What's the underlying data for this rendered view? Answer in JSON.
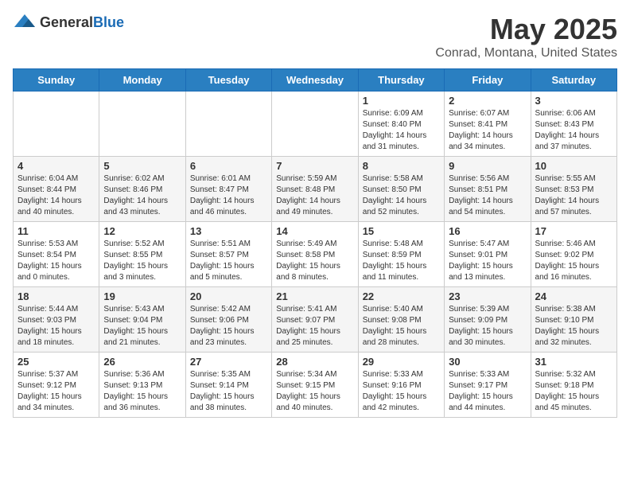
{
  "logo": {
    "text_general": "General",
    "text_blue": "Blue"
  },
  "header": {
    "month_year": "May 2025",
    "location": "Conrad, Montana, United States"
  },
  "weekdays": [
    "Sunday",
    "Monday",
    "Tuesday",
    "Wednesday",
    "Thursday",
    "Friday",
    "Saturday"
  ],
  "weeks": [
    [
      {
        "day": "",
        "info": ""
      },
      {
        "day": "",
        "info": ""
      },
      {
        "day": "",
        "info": ""
      },
      {
        "day": "",
        "info": ""
      },
      {
        "day": "1",
        "info": "Sunrise: 6:09 AM\nSunset: 8:40 PM\nDaylight: 14 hours\nand 31 minutes."
      },
      {
        "day": "2",
        "info": "Sunrise: 6:07 AM\nSunset: 8:41 PM\nDaylight: 14 hours\nand 34 minutes."
      },
      {
        "day": "3",
        "info": "Sunrise: 6:06 AM\nSunset: 8:43 PM\nDaylight: 14 hours\nand 37 minutes."
      }
    ],
    [
      {
        "day": "4",
        "info": "Sunrise: 6:04 AM\nSunset: 8:44 PM\nDaylight: 14 hours\nand 40 minutes."
      },
      {
        "day": "5",
        "info": "Sunrise: 6:02 AM\nSunset: 8:46 PM\nDaylight: 14 hours\nand 43 minutes."
      },
      {
        "day": "6",
        "info": "Sunrise: 6:01 AM\nSunset: 8:47 PM\nDaylight: 14 hours\nand 46 minutes."
      },
      {
        "day": "7",
        "info": "Sunrise: 5:59 AM\nSunset: 8:48 PM\nDaylight: 14 hours\nand 49 minutes."
      },
      {
        "day": "8",
        "info": "Sunrise: 5:58 AM\nSunset: 8:50 PM\nDaylight: 14 hours\nand 52 minutes."
      },
      {
        "day": "9",
        "info": "Sunrise: 5:56 AM\nSunset: 8:51 PM\nDaylight: 14 hours\nand 54 minutes."
      },
      {
        "day": "10",
        "info": "Sunrise: 5:55 AM\nSunset: 8:53 PM\nDaylight: 14 hours\nand 57 minutes."
      }
    ],
    [
      {
        "day": "11",
        "info": "Sunrise: 5:53 AM\nSunset: 8:54 PM\nDaylight: 15 hours\nand 0 minutes."
      },
      {
        "day": "12",
        "info": "Sunrise: 5:52 AM\nSunset: 8:55 PM\nDaylight: 15 hours\nand 3 minutes."
      },
      {
        "day": "13",
        "info": "Sunrise: 5:51 AM\nSunset: 8:57 PM\nDaylight: 15 hours\nand 5 minutes."
      },
      {
        "day": "14",
        "info": "Sunrise: 5:49 AM\nSunset: 8:58 PM\nDaylight: 15 hours\nand 8 minutes."
      },
      {
        "day": "15",
        "info": "Sunrise: 5:48 AM\nSunset: 8:59 PM\nDaylight: 15 hours\nand 11 minutes."
      },
      {
        "day": "16",
        "info": "Sunrise: 5:47 AM\nSunset: 9:01 PM\nDaylight: 15 hours\nand 13 minutes."
      },
      {
        "day": "17",
        "info": "Sunrise: 5:46 AM\nSunset: 9:02 PM\nDaylight: 15 hours\nand 16 minutes."
      }
    ],
    [
      {
        "day": "18",
        "info": "Sunrise: 5:44 AM\nSunset: 9:03 PM\nDaylight: 15 hours\nand 18 minutes."
      },
      {
        "day": "19",
        "info": "Sunrise: 5:43 AM\nSunset: 9:04 PM\nDaylight: 15 hours\nand 21 minutes."
      },
      {
        "day": "20",
        "info": "Sunrise: 5:42 AM\nSunset: 9:06 PM\nDaylight: 15 hours\nand 23 minutes."
      },
      {
        "day": "21",
        "info": "Sunrise: 5:41 AM\nSunset: 9:07 PM\nDaylight: 15 hours\nand 25 minutes."
      },
      {
        "day": "22",
        "info": "Sunrise: 5:40 AM\nSunset: 9:08 PM\nDaylight: 15 hours\nand 28 minutes."
      },
      {
        "day": "23",
        "info": "Sunrise: 5:39 AM\nSunset: 9:09 PM\nDaylight: 15 hours\nand 30 minutes."
      },
      {
        "day": "24",
        "info": "Sunrise: 5:38 AM\nSunset: 9:10 PM\nDaylight: 15 hours\nand 32 minutes."
      }
    ],
    [
      {
        "day": "25",
        "info": "Sunrise: 5:37 AM\nSunset: 9:12 PM\nDaylight: 15 hours\nand 34 minutes."
      },
      {
        "day": "26",
        "info": "Sunrise: 5:36 AM\nSunset: 9:13 PM\nDaylight: 15 hours\nand 36 minutes."
      },
      {
        "day": "27",
        "info": "Sunrise: 5:35 AM\nSunset: 9:14 PM\nDaylight: 15 hours\nand 38 minutes."
      },
      {
        "day": "28",
        "info": "Sunrise: 5:34 AM\nSunset: 9:15 PM\nDaylight: 15 hours\nand 40 minutes."
      },
      {
        "day": "29",
        "info": "Sunrise: 5:33 AM\nSunset: 9:16 PM\nDaylight: 15 hours\nand 42 minutes."
      },
      {
        "day": "30",
        "info": "Sunrise: 5:33 AM\nSunset: 9:17 PM\nDaylight: 15 hours\nand 44 minutes."
      },
      {
        "day": "31",
        "info": "Sunrise: 5:32 AM\nSunset: 9:18 PM\nDaylight: 15 hours\nand 45 minutes."
      }
    ]
  ]
}
